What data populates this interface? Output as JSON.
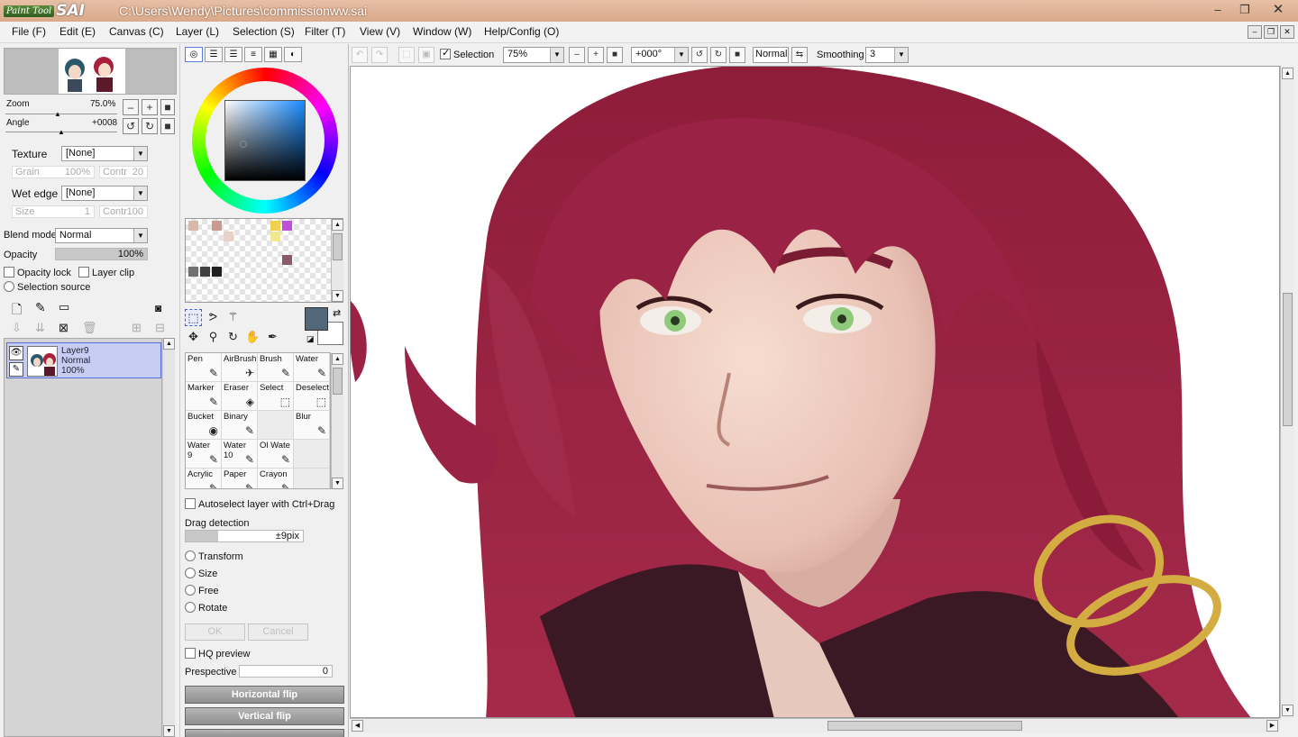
{
  "app": {
    "logo_small": "Paint Tool",
    "logo_big": "SAI",
    "file_path": "C:\\Users\\Wendy\\Pictures\\commissionww.sai"
  },
  "window_controls": {
    "minimize": "–",
    "maximize": "❐",
    "close": "✕"
  },
  "menu": [
    "File (F)",
    "Edit (E)",
    "Canvas (C)",
    "Layer (L)",
    "Selection (S)",
    "Filter (T)",
    "View (V)",
    "Window (W)",
    "Help/Config (O)"
  ],
  "navigator": {
    "zoom_label": "Zoom",
    "zoom_value": "75.0%",
    "angle_label": "Angle",
    "angle_value": "+0008"
  },
  "brush_settings": {
    "texture_label": "Texture",
    "texture_value": "[None]",
    "grain_label": "Grain",
    "grain_value": "100%",
    "contr_label": "Contr",
    "contr_value": "20",
    "wet_edge_label": "Wet edge",
    "wet_edge_value": "[None]",
    "size_label": "Size",
    "size_value": "1",
    "contr2_label": "Contr",
    "contr2_value": "100"
  },
  "layer_panel": {
    "blend_label": "Blend mode",
    "blend_value": "Normal",
    "opacity_label": "Opacity",
    "opacity_value": "100%",
    "opacity_lock": "Opacity lock",
    "layer_clip": "Layer clip",
    "selection_source": "Selection source",
    "layer": {
      "name": "Layer9",
      "mode": "Normal",
      "opacity": "100%"
    }
  },
  "brushes": [
    {
      "name": "Pen",
      "icon": "✎"
    },
    {
      "name": "AirBrush",
      "icon": "✈"
    },
    {
      "name": "Brush",
      "icon": "✎"
    },
    {
      "name": "Water",
      "icon": "✎"
    },
    {
      "name": "Marker",
      "icon": "✎"
    },
    {
      "name": "Eraser",
      "icon": "◈"
    },
    {
      "name": "Select",
      "icon": "⬚"
    },
    {
      "name": "Deselect",
      "icon": "⬚"
    },
    {
      "name": "Bucket",
      "icon": "◉"
    },
    {
      "name": "Binary",
      "icon": "✎"
    },
    {
      "name": "",
      "icon": ""
    },
    {
      "name": "Blur",
      "icon": "✎"
    },
    {
      "name": "Water\n9",
      "icon": "✎"
    },
    {
      "name": "Water\n10",
      "icon": "✎"
    },
    {
      "name": "Ol Wate",
      "icon": "✎"
    },
    {
      "name": "",
      "icon": ""
    },
    {
      "name": "Acrylic",
      "icon": "✎"
    },
    {
      "name": "Paper",
      "icon": "✎"
    },
    {
      "name": "Crayon",
      "icon": "✎"
    },
    {
      "name": "",
      "icon": ""
    }
  ],
  "tool_options": {
    "autoselect": "Autoselect layer with Ctrl+Drag",
    "drag_detection_label": "Drag detection",
    "drag_detection_value": "±9pix",
    "transform": "Transform",
    "size": "Size",
    "free": "Free",
    "rotate": "Rotate",
    "ok": "OK",
    "cancel": "Cancel",
    "hq_preview": "HQ preview",
    "perspective_label": "Prespective",
    "perspective_value": "0",
    "horizontal_flip": "Horizontal flip",
    "vertical_flip": "Vertical flip"
  },
  "canvas_toolbar": {
    "selection_label": "Selection",
    "zoom_value": "75%",
    "rotation_value": "+000°",
    "blend_value": "Normal",
    "smoothing_label": "Smoothing",
    "smoothing_value": "3"
  },
  "colors": {
    "primary": "#526879",
    "secondary": "#ffffff",
    "swatches": [
      "#d8b8a8",
      "#c89a90",
      "#e8d2c8",
      "#f0d050",
      "#c050d8",
      "#c0a0a0",
      "#f0e890",
      "#8a5a68",
      "#707070",
      "#404040",
      "#202020"
    ]
  },
  "icons": {
    "layer_tools": [
      "new-layer-icon",
      "new-linework-icon",
      "new-folder-icon",
      "transfer-icon",
      "merge-icon",
      "mask-icon",
      "delete-icon"
    ],
    "selection_tools": [
      "rect-select-icon",
      "lasso-icon",
      "magic-wand-icon",
      "move-icon",
      "zoom-icon",
      "rotate-icon",
      "hand-icon",
      "eyedropper-icon"
    ]
  }
}
